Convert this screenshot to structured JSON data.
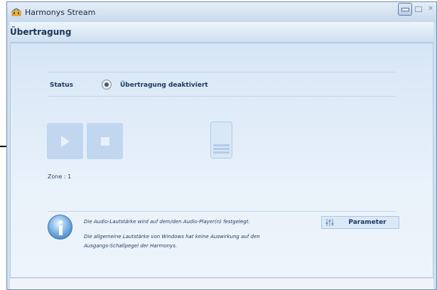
{
  "window": {
    "title": "Harmonys Stream",
    "buttons": {
      "minimize": "minimize",
      "maximize": "maximize",
      "close": "close"
    }
  },
  "header": {
    "title": "Übertragung"
  },
  "status": {
    "label": "Status",
    "value": "Übertragung deaktiviert"
  },
  "controls": {
    "play_icon": "play-icon",
    "stop_icon": "stop-icon",
    "volume_level": 0.35
  },
  "zone": {
    "label": "Zone : 1"
  },
  "info": {
    "line1": "Die Audio-Lautstärke wird auf dem/den Audio-Player(n) festgelegt.",
    "line2": "Die allgemeine Lautstärke von Windows hat keine Auswirkung auf den",
    "line3": "Ausgangs-Schallpegel der Harmonys."
  },
  "parameter_button": {
    "label": "Parameter",
    "icon": "sliders-icon"
  },
  "colors": {
    "accent": "#c0d7ef",
    "header_text": "#1a3556",
    "panel_bg": "#d6e6f6"
  }
}
